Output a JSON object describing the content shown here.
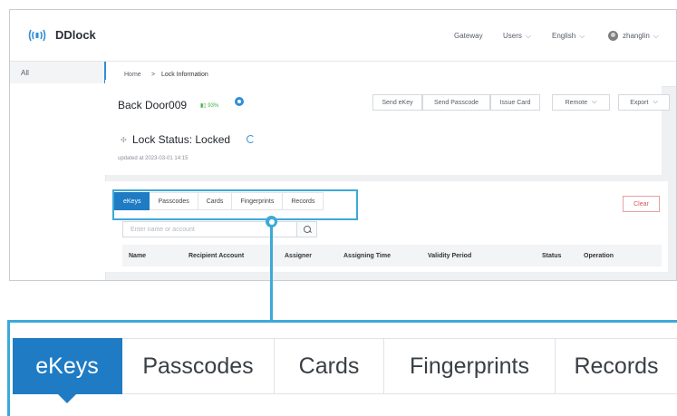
{
  "app": {
    "name": "DDlock",
    "logo_icon": "signal-waves-icon",
    "accent": "#1f7bc4"
  },
  "topbar": {
    "items": [
      {
        "label": "Gateway",
        "has_dropdown": false
      },
      {
        "label": "Users",
        "has_dropdown": true
      },
      {
        "label": "English",
        "has_dropdown": true
      }
    ],
    "user": {
      "name": "zhanglin",
      "has_dropdown": true
    }
  },
  "sidebar": {
    "items": [
      {
        "label": "All",
        "active": true
      }
    ]
  },
  "breadcrumb": {
    "home": "Home",
    "separator": ">",
    "current": "Lock Information"
  },
  "lock": {
    "name": "Back Door009",
    "battery": "93%",
    "status_label": "Lock Status: Locked",
    "updated": "updated at 2023-03-01 14:15"
  },
  "actions": {
    "send_ekey": "Send eKey",
    "send_passcode": "Send Passcode",
    "issue_card": "Issue Card",
    "remote": "Remote",
    "export": "Export"
  },
  "tabs": [
    {
      "label": "eKeys",
      "active": true
    },
    {
      "label": "Passcodes",
      "active": false
    },
    {
      "label": "Cards",
      "active": false
    },
    {
      "label": "Fingerprints",
      "active": false
    },
    {
      "label": "Records",
      "active": false
    }
  ],
  "clear_label": "Clear",
  "search": {
    "placeholder": "Enter name or account"
  },
  "table": {
    "columns": [
      "Name",
      "Recipient Account",
      "Assigner",
      "Assigning Time",
      "Validity Period",
      "Status",
      "Operation"
    ]
  },
  "highlight_color": "#3da9d8"
}
